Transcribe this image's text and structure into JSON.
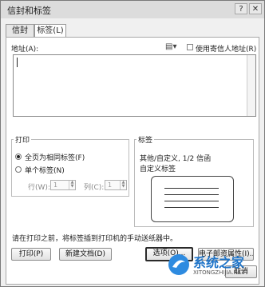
{
  "window": {
    "title": "信封和标签"
  },
  "tabs": [
    {
      "label": "信封(E)"
    },
    {
      "label": "标签(L)"
    }
  ],
  "address": {
    "label": "地址(A):",
    "use_return_label": "使用寄信人地址(R)"
  },
  "print": {
    "group_label": "打印",
    "full_page_label": "全页为相同标签(F)",
    "single_label": "单个标签(N)",
    "row_label": "行(W):",
    "row_value": "1",
    "col_label": "列(C):",
    "col_value": "1"
  },
  "label_box": {
    "group_label": "标签",
    "line1": "其他/自定义, 1/2 信函",
    "line2": "自定义标签"
  },
  "hint": "请在打印之前，将标签插到打印机的手动送纸器中。",
  "buttons": {
    "print": "打印(P)",
    "new_doc": "新建文档(D)",
    "options": "选项(O)...",
    "epostage": "电子邮资属性(I)...",
    "cancel": "取消"
  },
  "watermark": {
    "text": "系统之家",
    "url": "XITONGZHIJIA.NET"
  }
}
